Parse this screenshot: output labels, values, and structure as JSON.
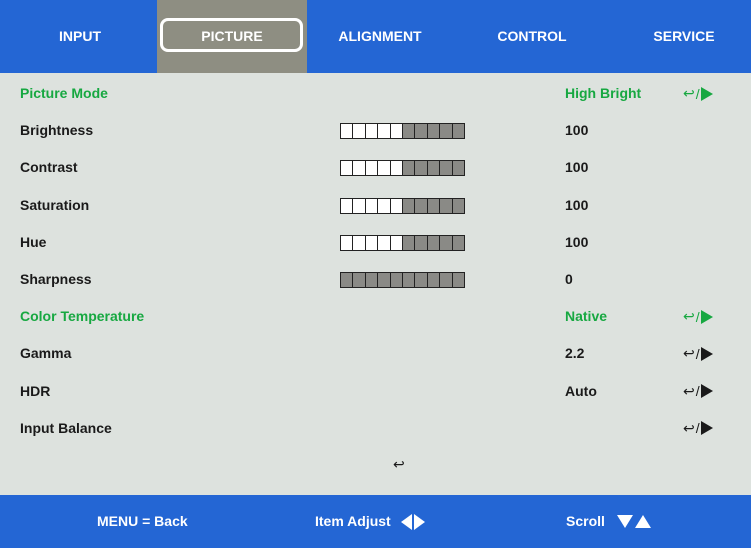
{
  "colors": {
    "header_blue": "#2466d4",
    "active_tab": "#8e8e82",
    "background": "#dde2de",
    "highlight_green": "#17a841",
    "slider_filled": "#8a8a86"
  },
  "tabs": [
    {
      "label": "INPUT",
      "active": false
    },
    {
      "label": "PICTURE",
      "active": true
    },
    {
      "label": "ALIGNMENT",
      "active": false
    },
    {
      "label": "CONTROL",
      "active": false
    },
    {
      "label": "SERVICE",
      "active": false
    }
  ],
  "rows": [
    {
      "label": "Picture Mode",
      "value": "High Bright",
      "highlight": true,
      "action": true
    },
    {
      "label": "Brightness",
      "value": "100",
      "slider_filled": 5,
      "slider_total": 10
    },
    {
      "label": "Contrast",
      "value": "100",
      "slider_filled": 5,
      "slider_total": 10
    },
    {
      "label": "Saturation",
      "value": "100",
      "slider_filled": 5,
      "slider_total": 10
    },
    {
      "label": "Hue",
      "value": "100",
      "slider_filled": 5,
      "slider_total": 10
    },
    {
      "label": "Sharpness",
      "value": "0",
      "slider_filled": 10,
      "slider_total": 10
    },
    {
      "label": "Color Temperature",
      "value": "Native",
      "highlight": true,
      "action": true
    },
    {
      "label": "Gamma",
      "value": "2.2",
      "action": true
    },
    {
      "label": "HDR",
      "value": "Auto",
      "action": true
    },
    {
      "label": "Input Balance",
      "value": "",
      "action": true
    }
  ],
  "action_glyph": {
    "enter": "↩",
    "separator": "/"
  },
  "enter_symbol": "↩",
  "footer": {
    "back": "MENU = Back",
    "adjust": "Item Adjust",
    "scroll": "Scroll"
  }
}
